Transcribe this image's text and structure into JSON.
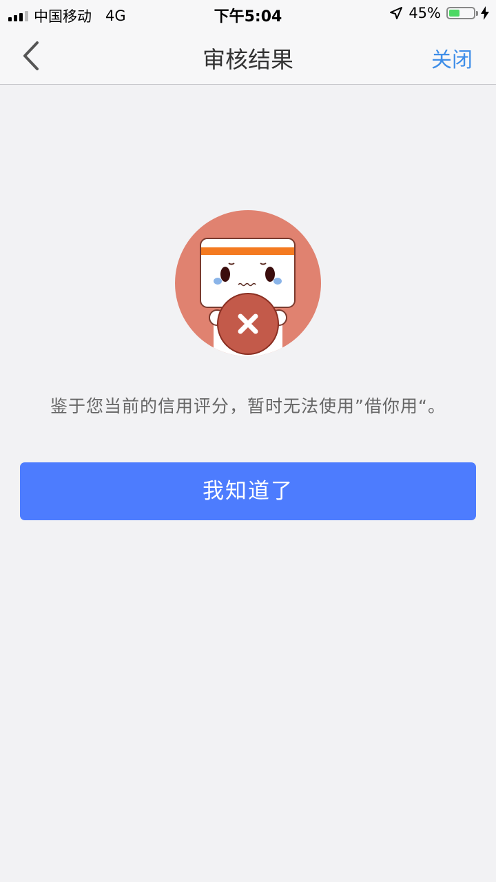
{
  "status_bar": {
    "carrier": "中国移动",
    "network": "4G",
    "time": "下午5:04",
    "battery_percent": "45%",
    "battery_level": 0.45
  },
  "nav": {
    "title": "审核结果",
    "close_label": "关闭"
  },
  "result": {
    "message": "鉴于您当前的信用评分，暂时无法使用”借你用“。"
  },
  "actions": {
    "confirm_label": "我知道了"
  },
  "colors": {
    "accent_blue": "#4d7cfe",
    "link_blue": "#3f8ee8",
    "illustration_circle": "#e08270",
    "reject_badge": "#c35a4a"
  }
}
